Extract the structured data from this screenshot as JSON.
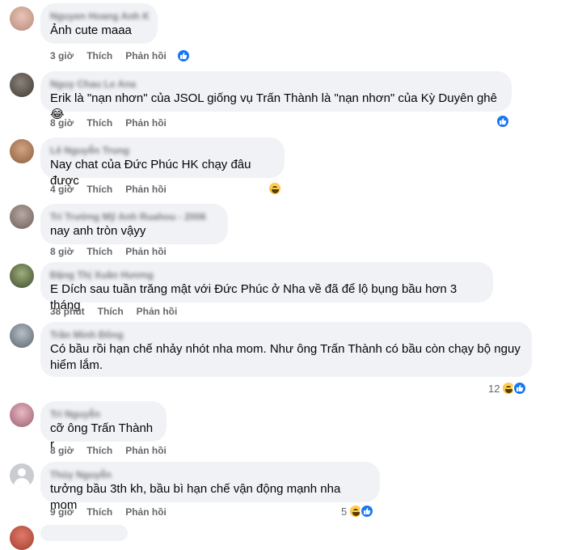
{
  "actions": {
    "like": "Thích",
    "reply": "Phản hồi"
  },
  "comments": [
    {
      "author": "Nguyen Hoang Anh K",
      "text": "Ảnh cute maaa",
      "time": "3 giờ",
      "reactions": ""
    },
    {
      "author": "Nguy Chau Le Ana",
      "text": "Erik là \"nạn nhơn\" của JSOL giống vụ Trấn Thành là \"nạn nhơn\" của Kỳ Duyên ghê 😂",
      "time": "8 giờ",
      "reactions": ""
    },
    {
      "author": "Lê Nguyễn Trung",
      "text": "Nay chat của Đức Phúc HK chạy đâu được",
      "time": "4 giờ",
      "reactions": ""
    },
    {
      "author": "Tri Trường Mỹ Anh Ruahou - 2006",
      "text": "nay anh tròn vậyy",
      "time": "8 giờ",
      "reactions": ""
    },
    {
      "author": "Đặng Thị Xuân Hương",
      "text": "E Dích sau tuần trăng mật với Đức Phúc ở Nha về đã để lộ bụng bầu hơn 3 tháng",
      "time": "38 phút",
      "reactions": ""
    },
    {
      "author": "Trần Minh Đông",
      "text": "Có bầu rồi hạn chế nhảy nhót nha mom. Như ông Trấn Thành có bầu còn chạy bộ nguy hiểm lắm.",
      "time": "8 giờ",
      "reactions": "12"
    },
    {
      "author": "Tri Nguyễn",
      "text": "cỡ ông Trấn Thành r",
      "time": "8 giờ",
      "reactions": ""
    },
    {
      "author": "Thủy Nguyễn",
      "text": "tưởng bầu 3th kh, bầu bì hạn chế vận động mạnh nha mom",
      "time": "9 giờ",
      "reactions": "5"
    }
  ],
  "colors": {
    "bubble": "#f0f2f5",
    "meta": "#65676b",
    "like": "#1877f2",
    "haha": "#f7b125"
  },
  "icons": [
    "like-reaction-icon",
    "haha-reaction-icon"
  ]
}
